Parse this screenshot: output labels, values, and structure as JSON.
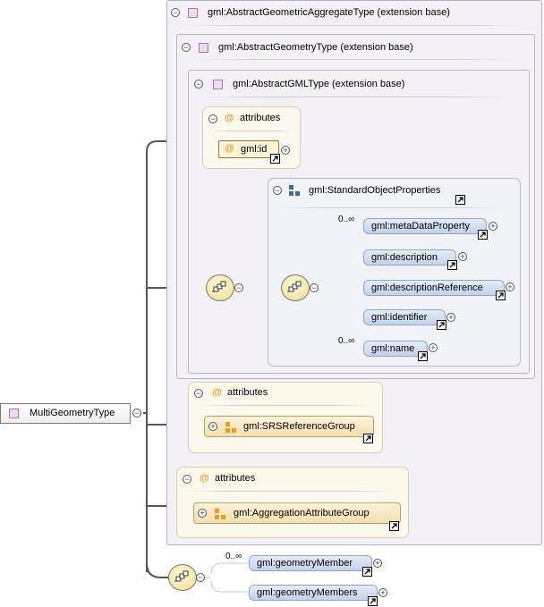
{
  "root": {
    "label": "MultiGeometryType"
  },
  "ext1": {
    "label": "gml:AbstractGeometricAggregateType (extension base)"
  },
  "ext2": {
    "label": "gml:AbstractGeometryType (extension base)"
  },
  "ext3": {
    "label": "gml:AbstractGMLType (extension base)"
  },
  "attrs_inner": {
    "title": "attributes",
    "item": "gml:id"
  },
  "std_group": {
    "label": "gml:StandardObjectProperties",
    "cardinality_first": "0..∞",
    "cardinality_last": "0..∞",
    "elements": [
      "gml:metaDataProperty",
      "gml:description",
      "gml:descriptionReference",
      "gml:identifier",
      "gml:name"
    ]
  },
  "attrs_srs": {
    "title": "attributes",
    "item": "gml:SRSReferenceGroup"
  },
  "attrs_agg": {
    "title": "attributes",
    "item": "gml:AggregationAttributeGroup"
  },
  "members": {
    "cardinality": "0..∞",
    "elements": [
      "gml:geometryMember",
      "gml:geometryMembers"
    ]
  },
  "colors": {
    "ext_bg": "#f3f1f6",
    "attr_bg": "#fdf8ec",
    "element_fill": "#c2d2ea",
    "connector": "#555555"
  },
  "symbols": {
    "at_sign": "@",
    "collapse": "−",
    "expand": "+"
  }
}
